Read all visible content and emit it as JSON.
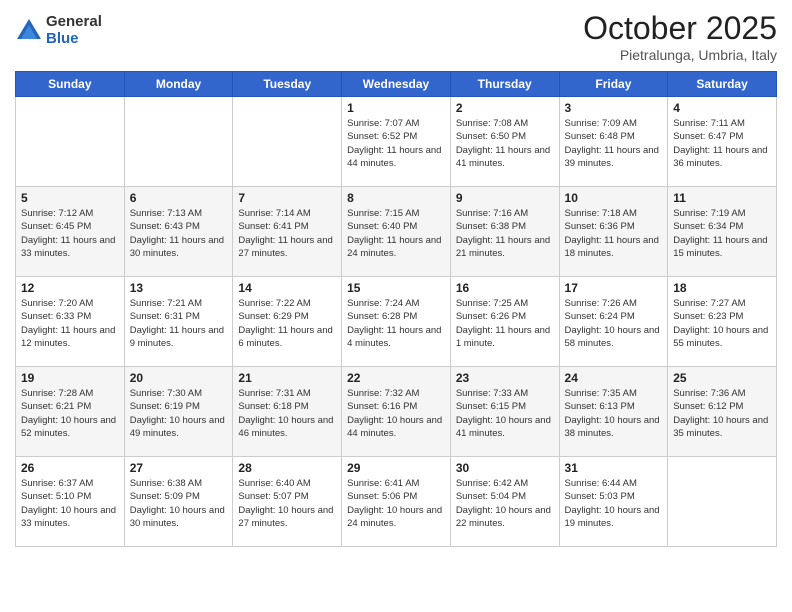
{
  "logo": {
    "general": "General",
    "blue": "Blue"
  },
  "header": {
    "month": "October 2025",
    "location": "Pietralunga, Umbria, Italy"
  },
  "weekdays": [
    "Sunday",
    "Monday",
    "Tuesday",
    "Wednesday",
    "Thursday",
    "Friday",
    "Saturday"
  ],
  "weeks": [
    [
      {
        "day": "",
        "info": ""
      },
      {
        "day": "",
        "info": ""
      },
      {
        "day": "",
        "info": ""
      },
      {
        "day": "1",
        "info": "Sunrise: 7:07 AM\nSunset: 6:52 PM\nDaylight: 11 hours and 44 minutes."
      },
      {
        "day": "2",
        "info": "Sunrise: 7:08 AM\nSunset: 6:50 PM\nDaylight: 11 hours and 41 minutes."
      },
      {
        "day": "3",
        "info": "Sunrise: 7:09 AM\nSunset: 6:48 PM\nDaylight: 11 hours and 39 minutes."
      },
      {
        "day": "4",
        "info": "Sunrise: 7:11 AM\nSunset: 6:47 PM\nDaylight: 11 hours and 36 minutes."
      }
    ],
    [
      {
        "day": "5",
        "info": "Sunrise: 7:12 AM\nSunset: 6:45 PM\nDaylight: 11 hours and 33 minutes."
      },
      {
        "day": "6",
        "info": "Sunrise: 7:13 AM\nSunset: 6:43 PM\nDaylight: 11 hours and 30 minutes."
      },
      {
        "day": "7",
        "info": "Sunrise: 7:14 AM\nSunset: 6:41 PM\nDaylight: 11 hours and 27 minutes."
      },
      {
        "day": "8",
        "info": "Sunrise: 7:15 AM\nSunset: 6:40 PM\nDaylight: 11 hours and 24 minutes."
      },
      {
        "day": "9",
        "info": "Sunrise: 7:16 AM\nSunset: 6:38 PM\nDaylight: 11 hours and 21 minutes."
      },
      {
        "day": "10",
        "info": "Sunrise: 7:18 AM\nSunset: 6:36 PM\nDaylight: 11 hours and 18 minutes."
      },
      {
        "day": "11",
        "info": "Sunrise: 7:19 AM\nSunset: 6:34 PM\nDaylight: 11 hours and 15 minutes."
      }
    ],
    [
      {
        "day": "12",
        "info": "Sunrise: 7:20 AM\nSunset: 6:33 PM\nDaylight: 11 hours and 12 minutes."
      },
      {
        "day": "13",
        "info": "Sunrise: 7:21 AM\nSunset: 6:31 PM\nDaylight: 11 hours and 9 minutes."
      },
      {
        "day": "14",
        "info": "Sunrise: 7:22 AM\nSunset: 6:29 PM\nDaylight: 11 hours and 6 minutes."
      },
      {
        "day": "15",
        "info": "Sunrise: 7:24 AM\nSunset: 6:28 PM\nDaylight: 11 hours and 4 minutes."
      },
      {
        "day": "16",
        "info": "Sunrise: 7:25 AM\nSunset: 6:26 PM\nDaylight: 11 hours and 1 minute."
      },
      {
        "day": "17",
        "info": "Sunrise: 7:26 AM\nSunset: 6:24 PM\nDaylight: 10 hours and 58 minutes."
      },
      {
        "day": "18",
        "info": "Sunrise: 7:27 AM\nSunset: 6:23 PM\nDaylight: 10 hours and 55 minutes."
      }
    ],
    [
      {
        "day": "19",
        "info": "Sunrise: 7:28 AM\nSunset: 6:21 PM\nDaylight: 10 hours and 52 minutes."
      },
      {
        "day": "20",
        "info": "Sunrise: 7:30 AM\nSunset: 6:19 PM\nDaylight: 10 hours and 49 minutes."
      },
      {
        "day": "21",
        "info": "Sunrise: 7:31 AM\nSunset: 6:18 PM\nDaylight: 10 hours and 46 minutes."
      },
      {
        "day": "22",
        "info": "Sunrise: 7:32 AM\nSunset: 6:16 PM\nDaylight: 10 hours and 44 minutes."
      },
      {
        "day": "23",
        "info": "Sunrise: 7:33 AM\nSunset: 6:15 PM\nDaylight: 10 hours and 41 minutes."
      },
      {
        "day": "24",
        "info": "Sunrise: 7:35 AM\nSunset: 6:13 PM\nDaylight: 10 hours and 38 minutes."
      },
      {
        "day": "25",
        "info": "Sunrise: 7:36 AM\nSunset: 6:12 PM\nDaylight: 10 hours and 35 minutes."
      }
    ],
    [
      {
        "day": "26",
        "info": "Sunrise: 6:37 AM\nSunset: 5:10 PM\nDaylight: 10 hours and 33 minutes."
      },
      {
        "day": "27",
        "info": "Sunrise: 6:38 AM\nSunset: 5:09 PM\nDaylight: 10 hours and 30 minutes."
      },
      {
        "day": "28",
        "info": "Sunrise: 6:40 AM\nSunset: 5:07 PM\nDaylight: 10 hours and 27 minutes."
      },
      {
        "day": "29",
        "info": "Sunrise: 6:41 AM\nSunset: 5:06 PM\nDaylight: 10 hours and 24 minutes."
      },
      {
        "day": "30",
        "info": "Sunrise: 6:42 AM\nSunset: 5:04 PM\nDaylight: 10 hours and 22 minutes."
      },
      {
        "day": "31",
        "info": "Sunrise: 6:44 AM\nSunset: 5:03 PM\nDaylight: 10 hours and 19 minutes."
      },
      {
        "day": "",
        "info": ""
      }
    ]
  ]
}
